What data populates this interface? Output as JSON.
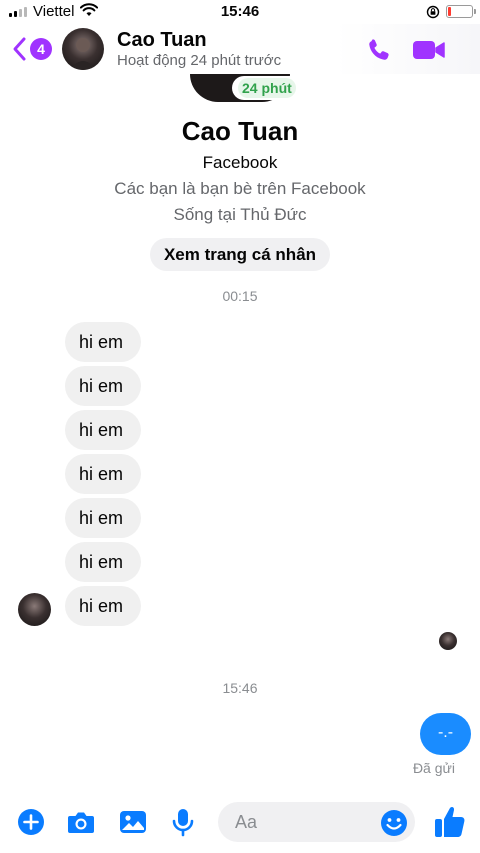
{
  "status_bar": {
    "carrier": "Viettel",
    "time": "15:46",
    "battery_level": 0.15
  },
  "header": {
    "back_count": "4",
    "contact_name": "Cao Tuan",
    "activity": "Hoạt động 24 phút trước",
    "icons": [
      "back-chevron-icon",
      "phone-icon",
      "video-camera-icon"
    ]
  },
  "profile": {
    "active_badge": "24 phút",
    "name": "Cao Tuan",
    "source": "Facebook",
    "friends_note": "Các bạn là bạn bè trên Facebook",
    "location": "Sống tại Thủ Đức",
    "view_profile_label": "Xem trang cá nhân"
  },
  "conversation": {
    "timestamp_1": "00:15",
    "received_messages": [
      "hi em",
      "hi em",
      "hi em",
      "hi em",
      "hi em",
      "hi em",
      "hi em"
    ],
    "timestamp_2": "15:46",
    "sent_message": "-.-",
    "delivery_status": "Đã gửi"
  },
  "composer": {
    "placeholder": "Aa",
    "tools": [
      "plus-icon",
      "camera-icon",
      "image-icon",
      "microphone-icon",
      "emoji-icon",
      "thumbs-up-icon"
    ]
  },
  "colors": {
    "accent_purple": "#a033ff",
    "composer_blue": "#0a7cff",
    "sent_bubble": "#1a8cff",
    "received_bubble": "#f0f0f0",
    "active_green": "#31a24c"
  }
}
